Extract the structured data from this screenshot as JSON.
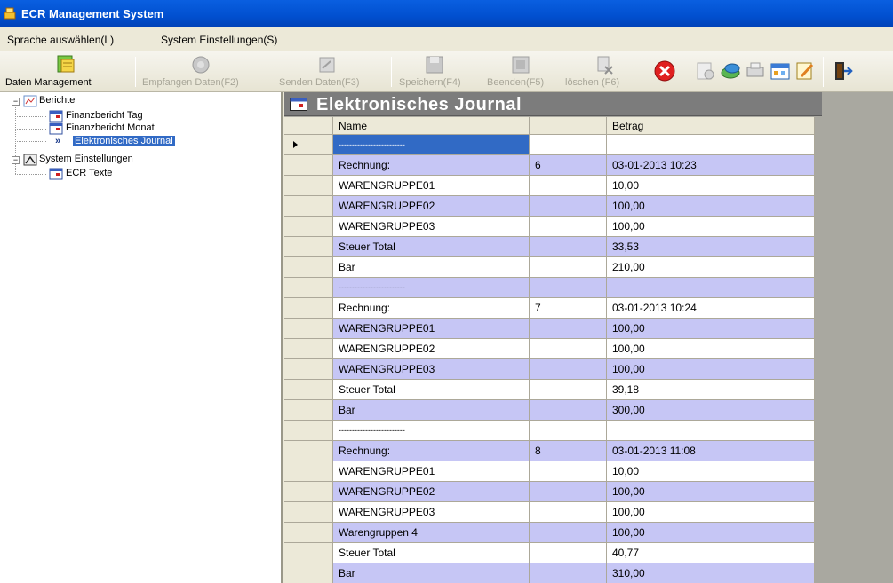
{
  "window": {
    "title": "ECR Management System",
    "app_icon": "ecr-app-icon"
  },
  "menu": [
    {
      "label": "Sprache auswählen(L)"
    },
    {
      "label": "System Einstellungen(S)"
    }
  ],
  "toolbar": {
    "buttons": [
      {
        "label": "Daten Management",
        "enabled": true,
        "icon": "data-management-icon"
      },
      {
        "label": "Empfangen Daten(F2)",
        "enabled": false,
        "icon": "receive-icon"
      },
      {
        "label": "Senden Daten(F3)",
        "enabled": false,
        "icon": "send-icon"
      },
      {
        "label": "Speichern(F4)",
        "enabled": false,
        "icon": "save-icon"
      },
      {
        "label": "Beenden(F5)",
        "enabled": false,
        "icon": "stop-icon"
      },
      {
        "label": "löschen   (F6)",
        "enabled": false,
        "icon": "delete-icon"
      }
    ],
    "small_icons": [
      "close-red-icon",
      "report-icon",
      "money-icon",
      "print-icon",
      "calendar-icon",
      "edit-icon",
      "exit-door-icon"
    ]
  },
  "tree": {
    "nodes": [
      {
        "label": "Berichte",
        "level": 0,
        "expanded": true,
        "icon": "reports-folder-icon"
      },
      {
        "label": "Finanzbericht Tag",
        "level": 1,
        "icon": "grid-icon"
      },
      {
        "label": "Finanzbericht Monat",
        "level": 1,
        "icon": "grid-icon"
      },
      {
        "label": "Elektronisches Journal",
        "level": 1,
        "icon": "arrow-icon",
        "prefix": "»",
        "selected": true
      },
      {
        "label": "System Einstellungen",
        "level": 0,
        "expanded": true,
        "icon": "settings-folder-icon"
      },
      {
        "label": "ECR Texte",
        "level": 1,
        "icon": "grid-icon"
      }
    ]
  },
  "journal": {
    "title": "Elektronisches Journal",
    "columns": [
      "Name",
      "",
      "Betrag"
    ],
    "rows": [
      {
        "name": "-------------------------",
        "num": "",
        "betrag": "",
        "alt": false,
        "selected": true,
        "dash": true
      },
      {
        "name": "Rechnung:",
        "num": "6",
        "betrag": "03-01-2013 10:23",
        "alt": true
      },
      {
        "name": "WARENGRUPPE01",
        "num": "",
        "betrag": "10,00",
        "alt": false
      },
      {
        "name": "WARENGRUPPE02",
        "num": "",
        "betrag": "100,00",
        "alt": true
      },
      {
        "name": "WARENGRUPPE03",
        "num": "",
        "betrag": "100,00",
        "alt": false
      },
      {
        "name": "Steuer Total",
        "num": "",
        "betrag": "33,53",
        "alt": true
      },
      {
        "name": "Bar",
        "num": "",
        "betrag": "210,00",
        "alt": false
      },
      {
        "name": "-------------------------",
        "num": "",
        "betrag": "",
        "alt": true,
        "dash": true
      },
      {
        "name": "Rechnung:",
        "num": "7",
        "betrag": "03-01-2013 10:24",
        "alt": false
      },
      {
        "name": "WARENGRUPPE01",
        "num": "",
        "betrag": "100,00",
        "alt": true
      },
      {
        "name": "WARENGRUPPE02",
        "num": "",
        "betrag": "100,00",
        "alt": false
      },
      {
        "name": "WARENGRUPPE03",
        "num": "",
        "betrag": "100,00",
        "alt": true
      },
      {
        "name": "Steuer Total",
        "num": "",
        "betrag": "39,18",
        "alt": false
      },
      {
        "name": "Bar",
        "num": "",
        "betrag": "300,00",
        "alt": true
      },
      {
        "name": "-------------------------",
        "num": "",
        "betrag": "",
        "alt": false,
        "dash": true
      },
      {
        "name": "Rechnung:",
        "num": "8",
        "betrag": "03-01-2013 11:08",
        "alt": true
      },
      {
        "name": "WARENGRUPPE01",
        "num": "",
        "betrag": "10,00",
        "alt": false
      },
      {
        "name": "WARENGRUPPE02",
        "num": "",
        "betrag": "100,00",
        "alt": true
      },
      {
        "name": "WARENGRUPPE03",
        "num": "",
        "betrag": "100,00",
        "alt": false
      },
      {
        "name": "Warengruppen 4",
        "num": "",
        "betrag": "100,00",
        "alt": true
      },
      {
        "name": "Steuer Total",
        "num": "",
        "betrag": "40,77",
        "alt": false
      },
      {
        "name": "Bar",
        "num": "",
        "betrag": "310,00",
        "alt": true
      }
    ]
  },
  "colors": {
    "row_alt": "#C6C6F5",
    "selection": "#316AC5",
    "title_bar": "#0150D0"
  }
}
